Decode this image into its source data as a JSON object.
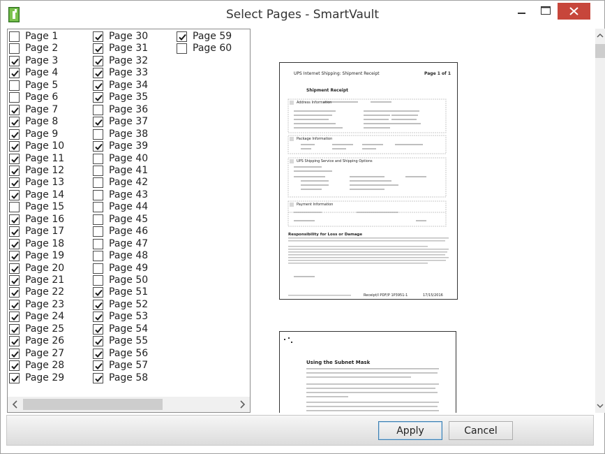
{
  "window": {
    "title": "Select Pages - SmartVault",
    "accent_close": "#c7463b"
  },
  "pages": [
    {
      "label": "Page 1",
      "checked": false
    },
    {
      "label": "Page 2",
      "checked": false
    },
    {
      "label": "Page 3",
      "checked": true
    },
    {
      "label": "Page 4",
      "checked": true
    },
    {
      "label": "Page 5",
      "checked": false
    },
    {
      "label": "Page 6",
      "checked": false
    },
    {
      "label": "Page 7",
      "checked": true
    },
    {
      "label": "Page 8",
      "checked": true
    },
    {
      "label": "Page 9",
      "checked": true
    },
    {
      "label": "Page 10",
      "checked": true
    },
    {
      "label": "Page 11",
      "checked": true
    },
    {
      "label": "Page 12",
      "checked": true
    },
    {
      "label": "Page 13",
      "checked": true
    },
    {
      "label": "Page 14",
      "checked": true
    },
    {
      "label": "Page 15",
      "checked": false
    },
    {
      "label": "Page 16",
      "checked": true
    },
    {
      "label": "Page 17",
      "checked": true
    },
    {
      "label": "Page 18",
      "checked": true
    },
    {
      "label": "Page 19",
      "checked": true
    },
    {
      "label": "Page 20",
      "checked": true
    },
    {
      "label": "Page 21",
      "checked": true
    },
    {
      "label": "Page 22",
      "checked": true
    },
    {
      "label": "Page 23",
      "checked": true
    },
    {
      "label": "Page 24",
      "checked": true
    },
    {
      "label": "Page 25",
      "checked": true
    },
    {
      "label": "Page 26",
      "checked": true
    },
    {
      "label": "Page 27",
      "checked": true
    },
    {
      "label": "Page 28",
      "checked": true
    },
    {
      "label": "Page 29",
      "checked": true
    },
    {
      "label": "Page 30",
      "checked": true
    },
    {
      "label": "Page 31",
      "checked": true
    },
    {
      "label": "Page 32",
      "checked": true
    },
    {
      "label": "Page 33",
      "checked": true
    },
    {
      "label": "Page 34",
      "checked": true
    },
    {
      "label": "Page 35",
      "checked": true
    },
    {
      "label": "Page 36",
      "checked": false
    },
    {
      "label": "Page 37",
      "checked": true
    },
    {
      "label": "Page 38",
      "checked": false
    },
    {
      "label": "Page 39",
      "checked": true
    },
    {
      "label": "Page 40",
      "checked": false
    },
    {
      "label": "Page 41",
      "checked": false
    },
    {
      "label": "Page 42",
      "checked": false
    },
    {
      "label": "Page 43",
      "checked": false
    },
    {
      "label": "Page 44",
      "checked": false
    },
    {
      "label": "Page 45",
      "checked": false
    },
    {
      "label": "Page 46",
      "checked": false
    },
    {
      "label": "Page 47",
      "checked": false
    },
    {
      "label": "Page 48",
      "checked": false
    },
    {
      "label": "Page 49",
      "checked": false
    },
    {
      "label": "Page 50",
      "checked": false
    },
    {
      "label": "Page 51",
      "checked": true
    },
    {
      "label": "Page 52",
      "checked": true
    },
    {
      "label": "Page 53",
      "checked": true
    },
    {
      "label": "Page 54",
      "checked": true
    },
    {
      "label": "Page 55",
      "checked": true
    },
    {
      "label": "Page 56",
      "checked": true
    },
    {
      "label": "Page 57",
      "checked": true
    },
    {
      "label": "Page 58",
      "checked": true
    },
    {
      "label": "Page 59",
      "checked": true
    },
    {
      "label": "Page 60",
      "checked": false
    }
  ],
  "preview": {
    "page1": {
      "header_left": "UPS Internet Shipping: Shipment Receipt",
      "header_right": "Page 1 of 1",
      "heading": "Shipment Receipt",
      "section_address": "Address Information",
      "section_package": "Package Information",
      "section_service": "UPS Shipping Service and Shipping Options",
      "section_payment": "Payment Information",
      "notice_heading": "Responsibility for Loss or Damage",
      "footer_text": "Receipt/I PDF/P 1P3951-1",
      "footer_date": "17/15/2016"
    },
    "page2": {
      "heading": "Using the Subnet Mask"
    }
  },
  "buttons": {
    "apply": "Apply",
    "cancel": "Cancel"
  },
  "icons": {
    "app": "smartvault-icon",
    "minimize": "minimize-icon",
    "maximize": "maximize-icon",
    "close": "close-icon"
  }
}
